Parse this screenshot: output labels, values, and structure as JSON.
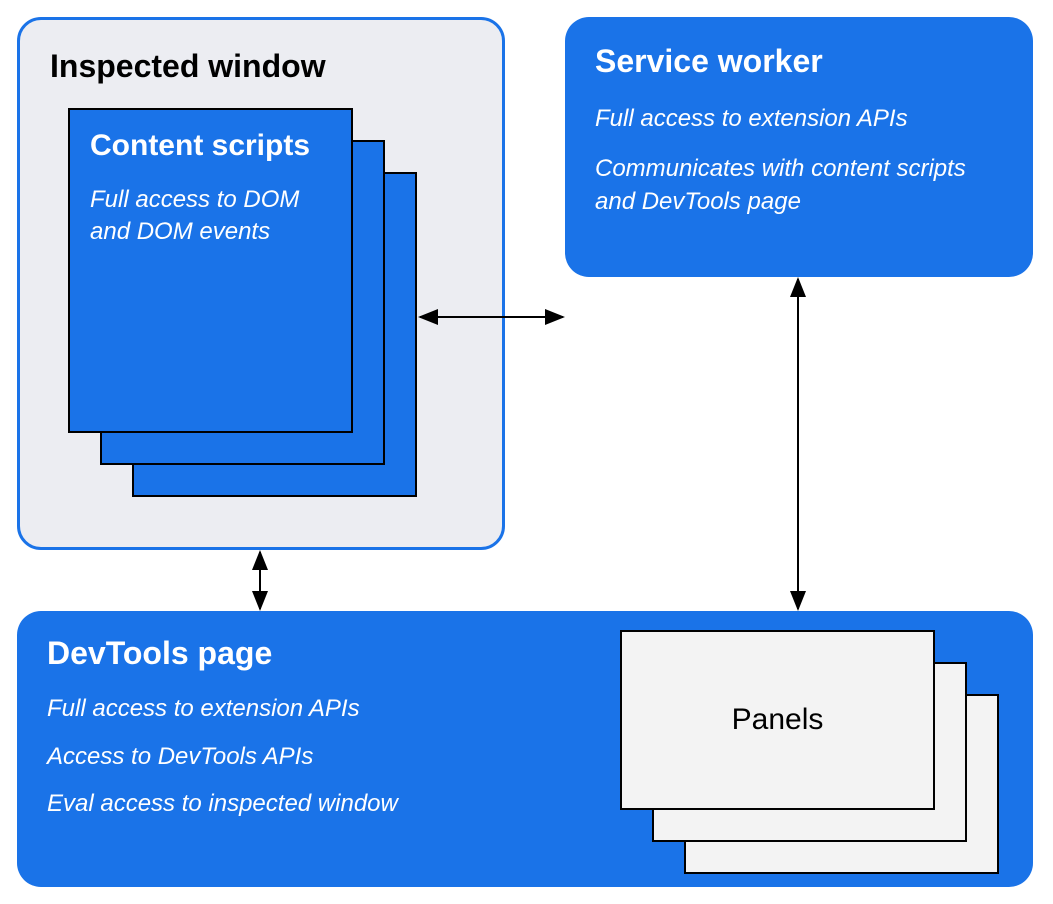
{
  "inspected_window": {
    "title": "Inspected window",
    "content_scripts": {
      "title": "Content scripts",
      "desc": "Full access to DOM and DOM events"
    }
  },
  "service_worker": {
    "title": "Service worker",
    "desc1": "Full access to extension APIs",
    "desc2": "Communicates with content scripts and DevTools page"
  },
  "devtools_page": {
    "title": "DevTools page",
    "desc1": "Full access to extension APIs",
    "desc2": "Access to DevTools APIs",
    "desc3": "Eval access to inspected window"
  },
  "panels": {
    "label": "Panels"
  },
  "colors": {
    "blue": "#1a73e8",
    "grey_bg": "#ecedf2",
    "panel_bg": "#f3f3f3"
  }
}
